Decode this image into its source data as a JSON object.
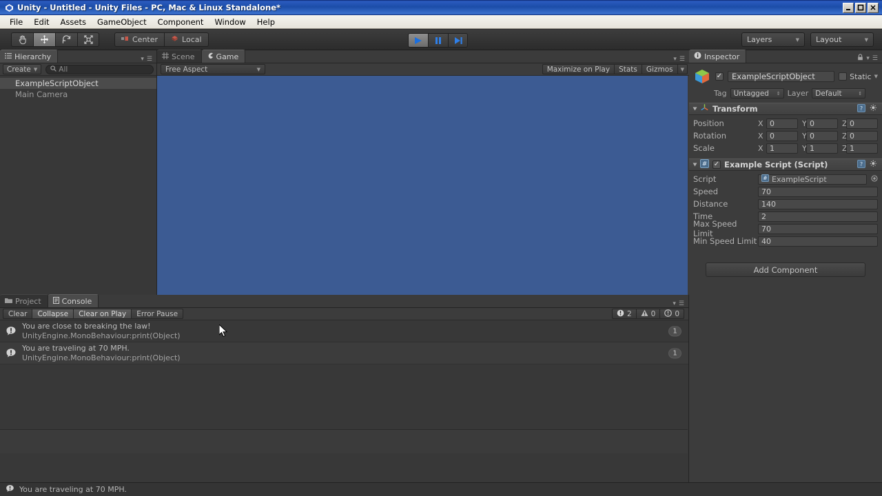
{
  "window": {
    "title": "Unity - Untitled - Unity Files - PC, Mac & Linux Standalone*",
    "app_icon": "unity-icon",
    "minimize": "_",
    "maximize": "□",
    "close": "✕"
  },
  "menubar": {
    "items": [
      "File",
      "Edit",
      "Assets",
      "GameObject",
      "Component",
      "Window",
      "Help"
    ]
  },
  "toolbar": {
    "transform_tools": [
      {
        "name": "hand-tool",
        "active": false
      },
      {
        "name": "move-tool",
        "active": true
      },
      {
        "name": "rotate-tool",
        "active": false
      },
      {
        "name": "scale-tool",
        "active": false
      }
    ],
    "pivot_label": "Center",
    "rotation_label": "Local",
    "play_buttons": [
      {
        "name": "play-button",
        "active": true
      },
      {
        "name": "pause-button",
        "active": false
      },
      {
        "name": "step-button",
        "active": false
      }
    ],
    "layers_label": "Layers",
    "layout_label": "Layout"
  },
  "hierarchy": {
    "tab_label": "Hierarchy",
    "create_label": "Create",
    "search_placeholder": "All",
    "items": [
      {
        "label": "ExampleScriptObject",
        "selected": true
      },
      {
        "label": "Main Camera",
        "selected": false
      }
    ]
  },
  "gameview": {
    "tabs": [
      {
        "label": "Scene",
        "selected": false,
        "icon": "grid-icon"
      },
      {
        "label": "Game",
        "selected": true,
        "icon": "gamepad-icon"
      }
    ],
    "aspect_label": "Free Aspect",
    "maximize_label": "Maximize on Play",
    "stats_label": "Stats",
    "gizmos_label": "Gizmos",
    "background_color": "#3c5b93"
  },
  "console": {
    "tabs": [
      {
        "label": "Project",
        "selected": false,
        "icon": "folder-icon"
      },
      {
        "label": "Console",
        "selected": true,
        "icon": "console-icon"
      }
    ],
    "buttons": [
      {
        "label": "Clear",
        "active": false
      },
      {
        "label": "Collapse",
        "active": true
      },
      {
        "label": "Clear on Play",
        "active": true
      },
      {
        "label": "Error Pause",
        "active": false
      }
    ],
    "counters": [
      {
        "icon": "error-icon",
        "count": "2"
      },
      {
        "icon": "warning-icon",
        "count": "0"
      },
      {
        "icon": "info-icon",
        "count": "0"
      }
    ],
    "messages": [
      {
        "line1": "You are close to breaking the law!",
        "line2": "UnityEngine.MonoBehaviour:print(Object)",
        "badge": "1"
      },
      {
        "line1": "You are traveling at 70 MPH.",
        "line2": "UnityEngine.MonoBehaviour:print(Object)",
        "badge": "1"
      }
    ]
  },
  "inspector": {
    "tab_label": "Inspector",
    "object_name": "ExampleScriptObject",
    "object_enabled": true,
    "static_label": "Static",
    "static_checked": false,
    "tag_label": "Tag",
    "tag_value": "Untagged",
    "layer_label": "Layer",
    "layer_value": "Default",
    "transform": {
      "title": "Transform",
      "rows": [
        {
          "name": "Position",
          "x": "0",
          "y": "0",
          "z": "0"
        },
        {
          "name": "Rotation",
          "x": "0",
          "y": "0",
          "z": "0"
        },
        {
          "name": "Scale",
          "x": "1",
          "y": "1",
          "z": "1"
        }
      ],
      "axis_labels": [
        "X",
        "Y",
        "Z"
      ]
    },
    "script_component": {
      "title": "Example Script (Script)",
      "enabled": true,
      "script_label": "Script",
      "script_value": "ExampleScript",
      "fields": [
        {
          "name": "Speed",
          "value": "70"
        },
        {
          "name": "Distance",
          "value": "140"
        },
        {
          "name": "Time",
          "value": "2"
        },
        {
          "name": "Max Speed Limit",
          "value": "70"
        },
        {
          "name": "Min Speed Limit",
          "value": "40"
        }
      ]
    },
    "add_component_label": "Add Component"
  },
  "statusbar": {
    "icon": "error-icon",
    "message": "You are traveling at 70 MPH."
  }
}
